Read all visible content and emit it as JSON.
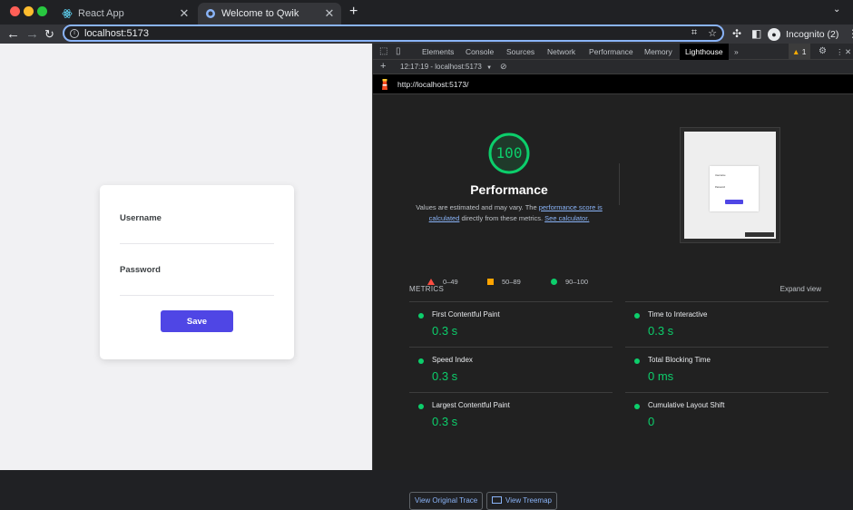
{
  "browser": {
    "tabs": [
      {
        "title": "React App",
        "icon": "react-icon",
        "active": false
      },
      {
        "title": "Welcome to Qwik",
        "icon": "globe-icon",
        "active": true
      }
    ],
    "url": "localhost:5173",
    "profile": "Incognito (2)"
  },
  "login_form": {
    "username_label": "Username",
    "username_value": "",
    "password_label": "Password",
    "password_value": "",
    "save_label": "Save",
    "accent_color": "#4f46e5"
  },
  "devtools": {
    "tabs": [
      "Elements",
      "Console",
      "Sources",
      "Network",
      "Performance",
      "Memory",
      "Lighthouse"
    ],
    "active_tab": "Lighthouse",
    "warning_count": "1",
    "report_select": "12:17:19 - localhost:5173",
    "report_url": "http://localhost:5173/"
  },
  "lighthouse": {
    "score": "100",
    "score_fraction": 1.0,
    "category": "Performance",
    "desc_prefix": "Values are estimated and may vary. The ",
    "desc_link1": "performance score is calculated",
    "desc_middle": " directly from these metrics. ",
    "desc_link2": "See calculator.",
    "legend": [
      {
        "label": "0–49",
        "shape": "triangle",
        "color": "#ff4e42"
      },
      {
        "label": "50–89",
        "shape": "square",
        "color": "#ffa400"
      },
      {
        "label": "90–100",
        "shape": "circle",
        "color": "#0cce6b"
      }
    ],
    "metrics_heading": "METRICS",
    "expand_label": "Expand view",
    "metrics": [
      {
        "label": "First Contentful Paint",
        "value": "0.3 s"
      },
      {
        "label": "Time to Interactive",
        "value": "0.3 s"
      },
      {
        "label": "Speed Index",
        "value": "0.3 s"
      },
      {
        "label": "Total Blocking Time",
        "value": "0 ms"
      },
      {
        "label": "Largest Contentful Paint",
        "value": "0.3 s"
      },
      {
        "label": "Cumulative Layout Shift",
        "value": "0"
      }
    ],
    "buttons": {
      "trace": "View Original Trace",
      "treemap": "View Treemap"
    },
    "thumb": {
      "username": "Username",
      "password": "Password",
      "save": "Save"
    },
    "pass_color": "#0cce6b"
  }
}
